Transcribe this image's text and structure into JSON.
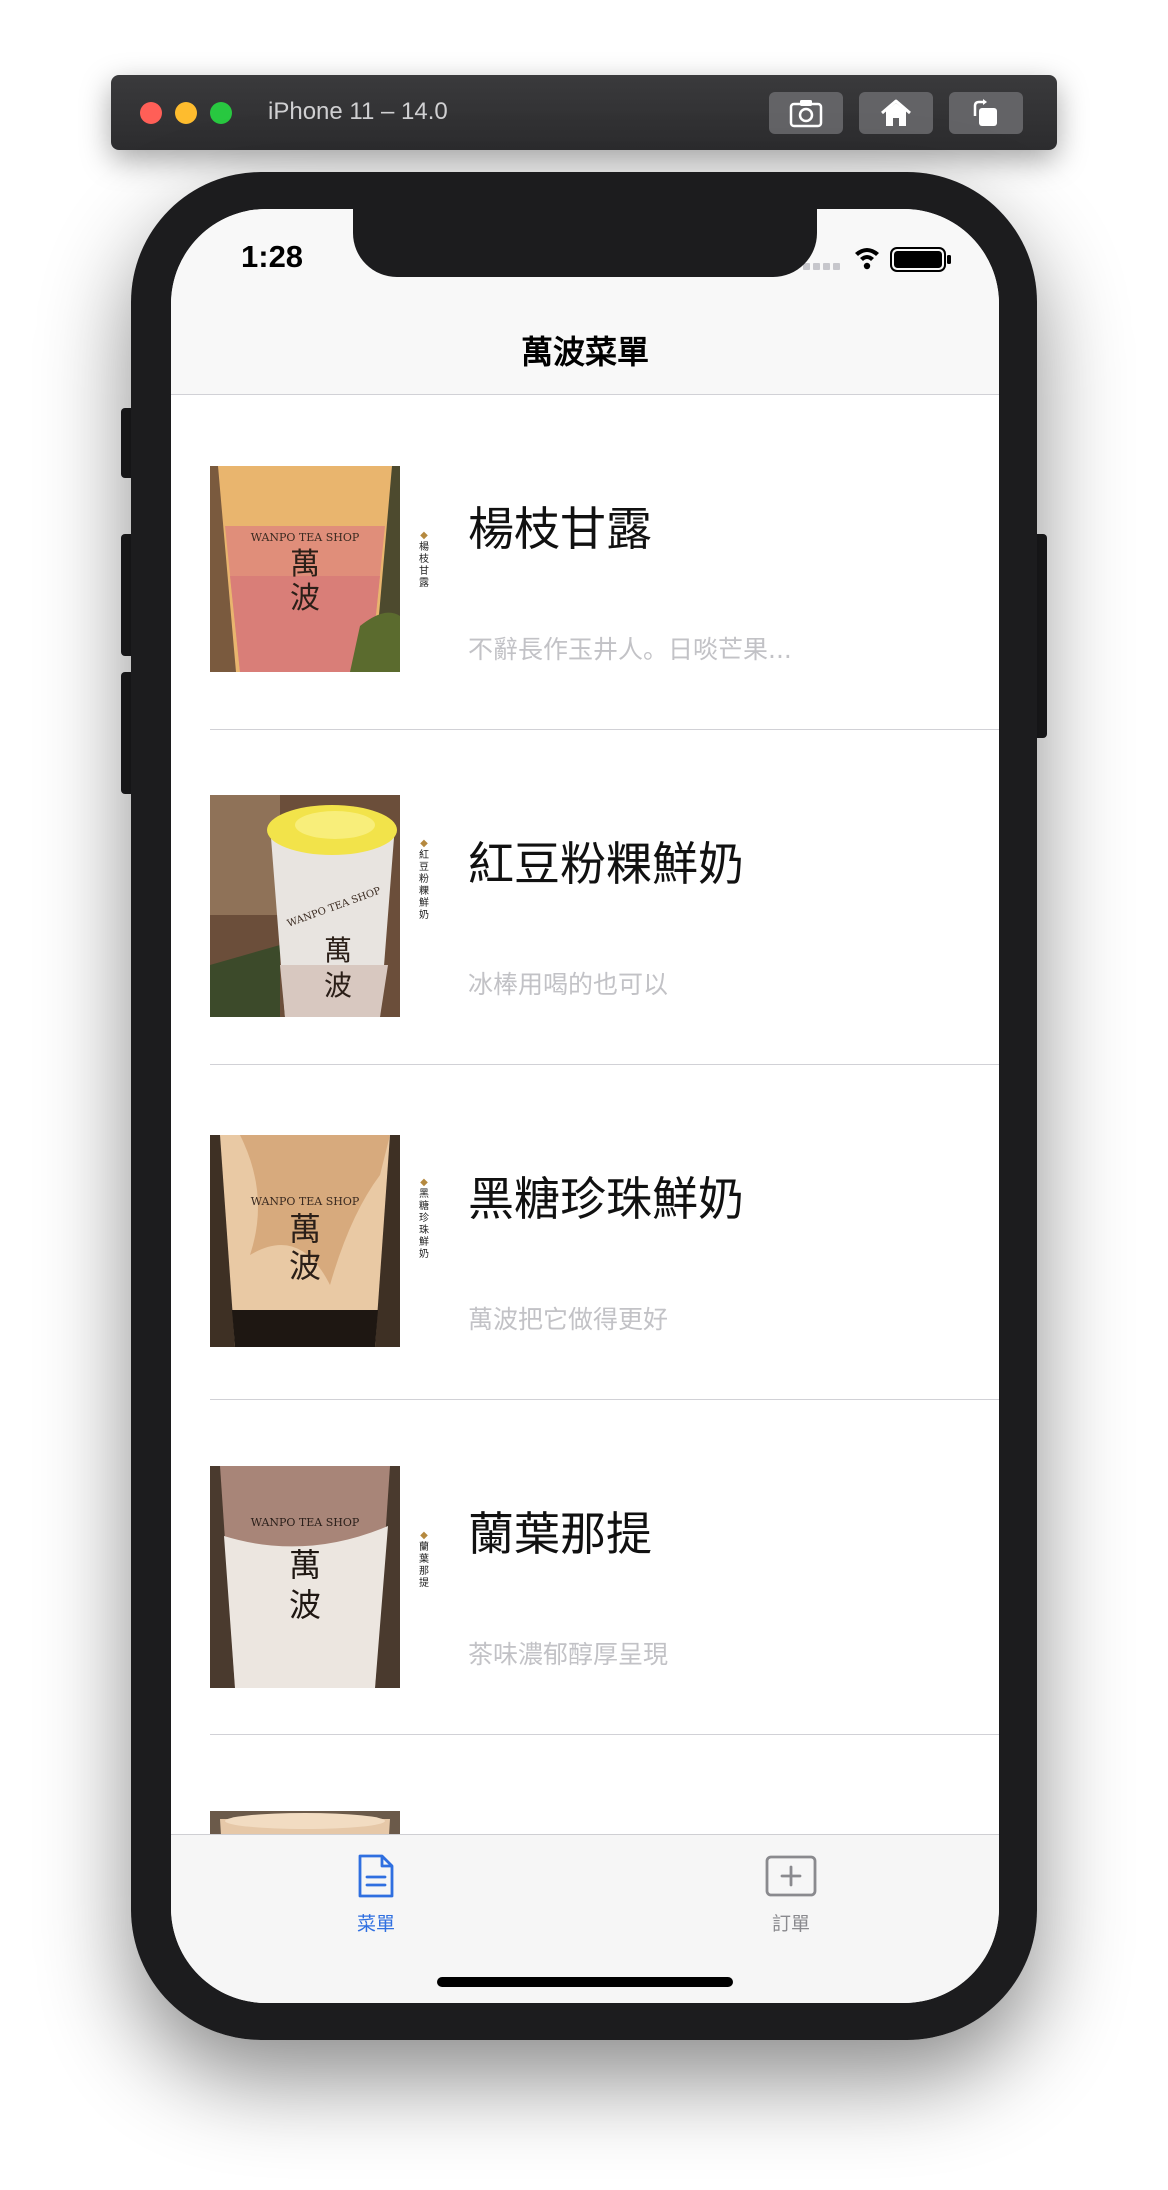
{
  "simulator": {
    "title": "iPhone 11 – 14.0",
    "buttons": [
      "screenshot-icon",
      "home-icon",
      "rotate-icon"
    ]
  },
  "status_bar": {
    "time": "1:28"
  },
  "nav": {
    "title": "萬波菜單"
  },
  "menu_items": [
    {
      "name": "楊枝甘露",
      "side_label": "楊枝甘露",
      "description": "不辭長作玉井人。日啖芒果..."
    },
    {
      "name": "紅豆粉粿鮮奶",
      "side_label": "紅豆粉粿鮮奶",
      "description": "冰棒用喝的也可以"
    },
    {
      "name": "黑糖珍珠鮮奶",
      "side_label": "黑糖珍珠鮮奶",
      "description": "萬波把它做得更好"
    },
    {
      "name": "蘭葉那提",
      "side_label": "蘭葉那提",
      "description": "茶味濃郁醇厚呈現"
    }
  ],
  "tab_bar": {
    "menu_label": "菜單",
    "order_label": "訂單"
  },
  "colors": {
    "accent": "#2f6fe0",
    "description_text": "#c2c2c6",
    "inactive_tab": "#8a8a8e"
  }
}
